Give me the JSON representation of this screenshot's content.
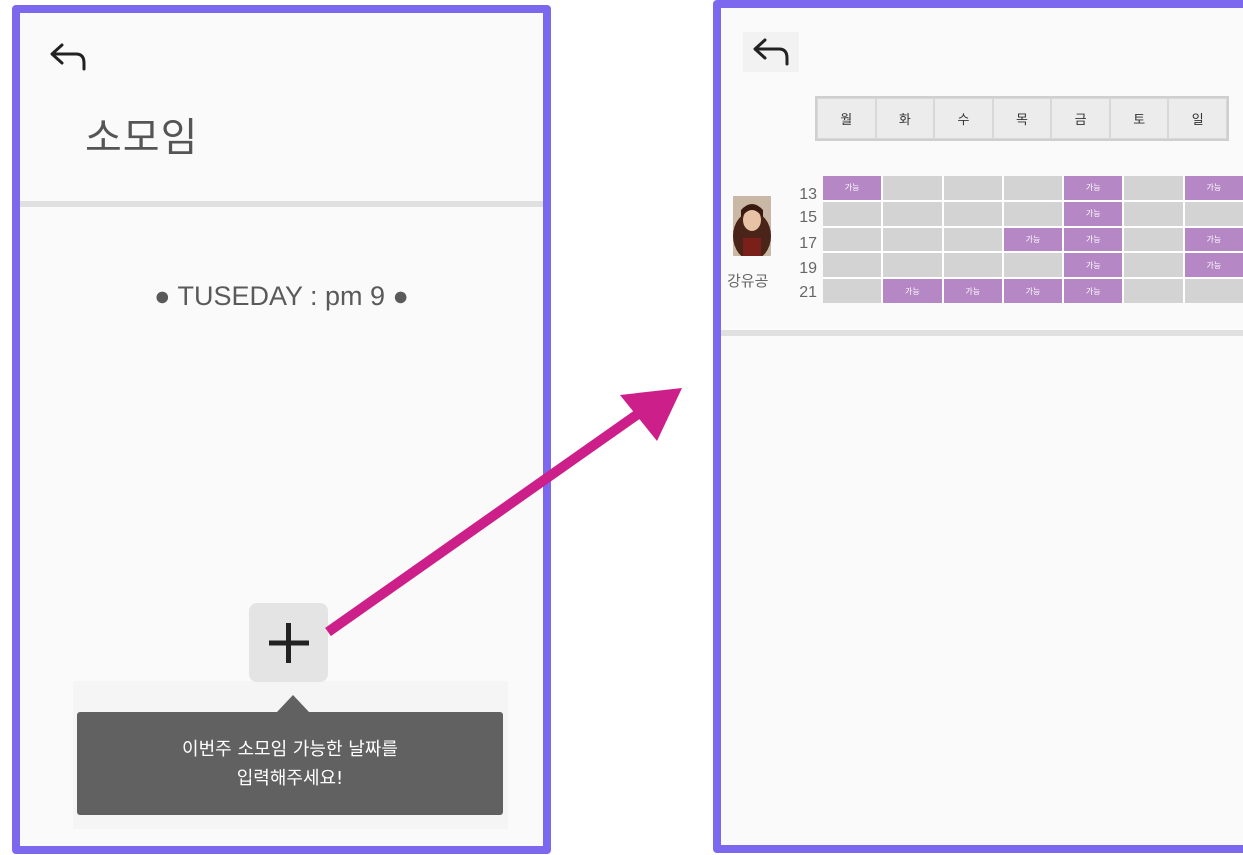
{
  "left_screen": {
    "title": "소모임",
    "schedule_text": "● TUSEDAY : pm 9 ●",
    "add_icon": "plus-icon",
    "tooltip": {
      "line1": "이번주 소모임 가능한 날짜를",
      "line2": "입력해주세요!"
    }
  },
  "right_screen": {
    "days": [
      "월",
      "화",
      "수",
      "목",
      "금",
      "토",
      "일"
    ],
    "member": {
      "name": "강유공",
      "avatar": "avatar-photo"
    },
    "hours": [
      "13",
      "15",
      "17",
      "19",
      "21"
    ],
    "available_label": "가능",
    "availability": [
      [
        true,
        false,
        false,
        false,
        true,
        false,
        true
      ],
      [
        false,
        false,
        false,
        false,
        true,
        false,
        false
      ],
      [
        false,
        false,
        false,
        true,
        true,
        false,
        true
      ],
      [
        false,
        false,
        false,
        false,
        true,
        false,
        true
      ],
      [
        false,
        true,
        true,
        true,
        true,
        false,
        false
      ]
    ]
  },
  "colors": {
    "frame": "#7b68ee",
    "arrow": "#cc1f8a",
    "available": "#b587c4",
    "unavailable": "#d3d3d3",
    "tooltip_bg": "#616161"
  }
}
